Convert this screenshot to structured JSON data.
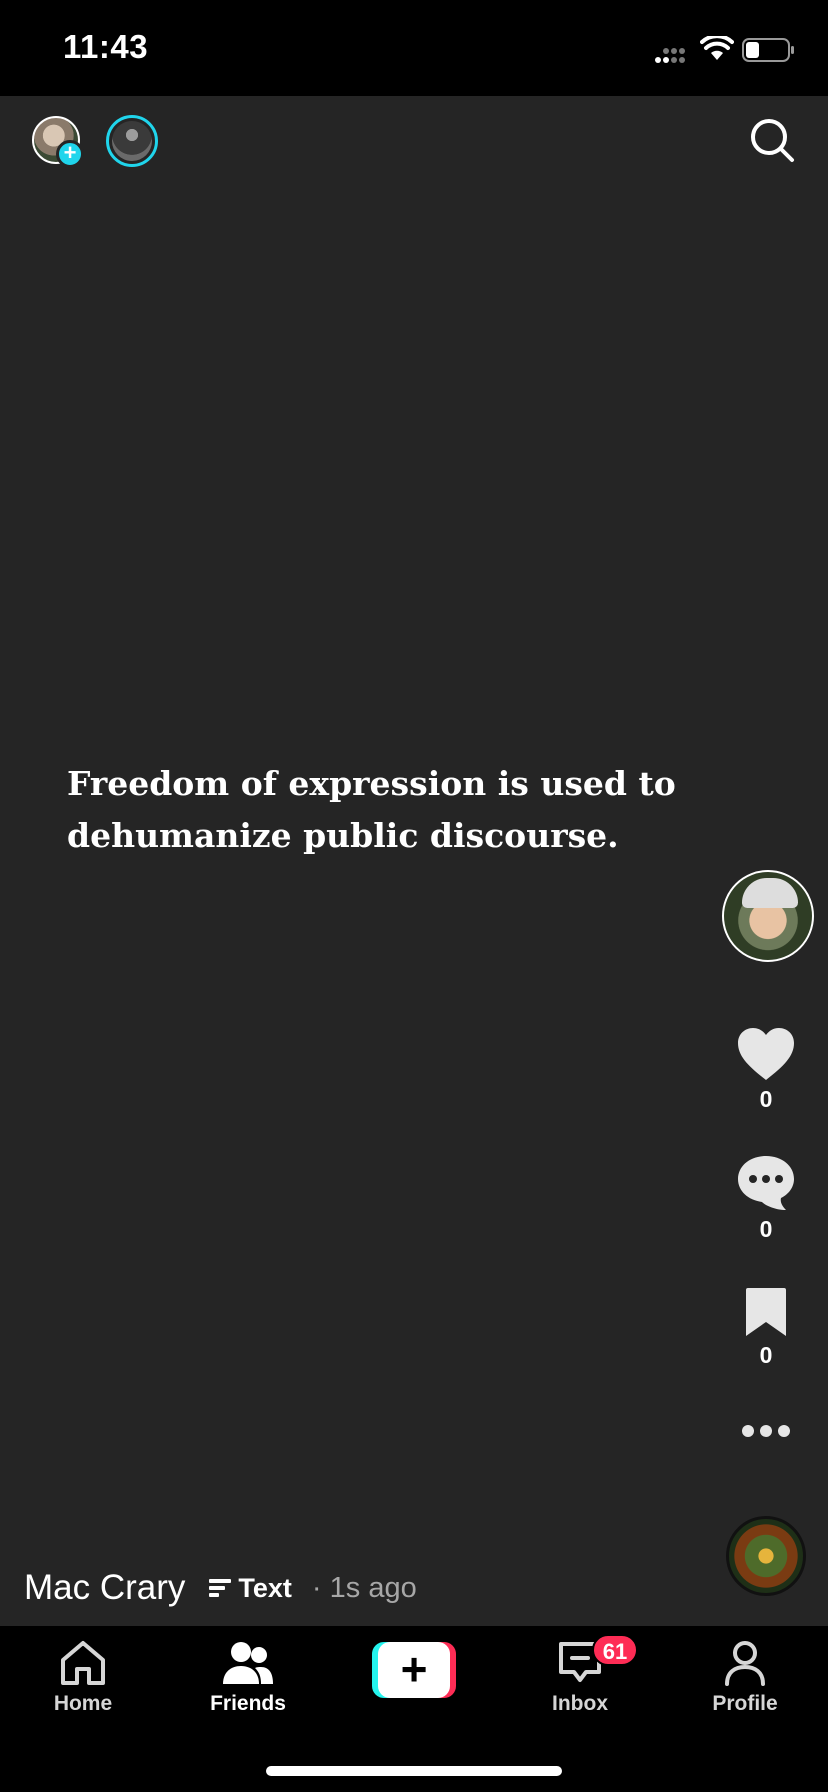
{
  "status_bar": {
    "time": "11:43"
  },
  "feed": {
    "post_text": "Freedom of expression is used to dehumanize public discourse.",
    "author": "Mac Crary",
    "post_type": "Text",
    "time_ago": "· 1s ago"
  },
  "actions": {
    "likes": "0",
    "comments": "0",
    "bookmarks": "0"
  },
  "tabs": [
    {
      "label": "Home",
      "icon": "home-icon"
    },
    {
      "label": "Friends",
      "icon": "friends-icon"
    },
    {
      "label": "",
      "icon": "plus-icon"
    },
    {
      "label": "Inbox",
      "icon": "inbox-icon",
      "badge": "61"
    },
    {
      "label": "Profile",
      "icon": "profile-icon"
    }
  ],
  "colors": {
    "feed_background": "#252525",
    "accent_cyan": "#20d5ec",
    "accent_red": "#fe2c55"
  }
}
